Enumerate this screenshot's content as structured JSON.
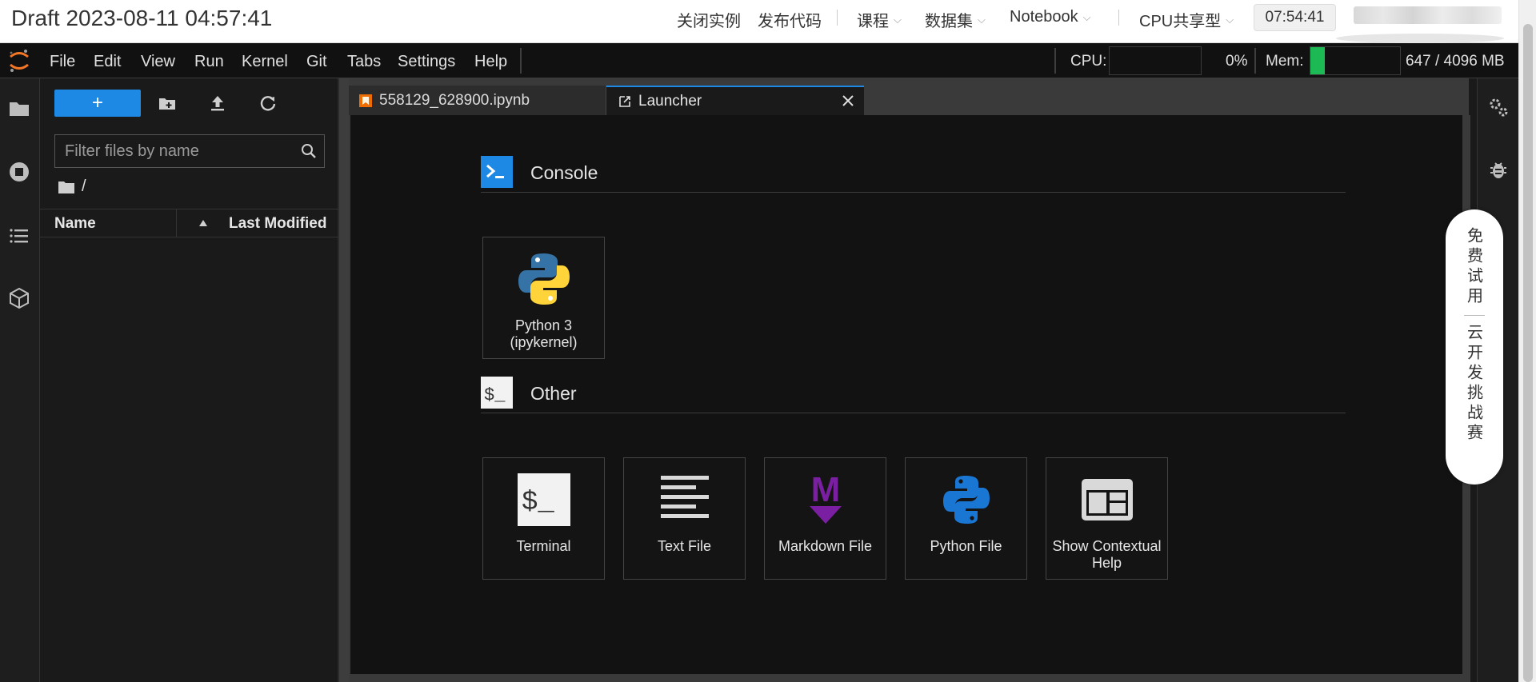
{
  "topbar": {
    "draft_title": "Draft 2023-08-11 04:57:41",
    "actions": [
      "关闭实例",
      "发布代码"
    ],
    "dropdowns": [
      "课程",
      "数据集",
      "Notebook",
      "CPU共享型"
    ],
    "timer": "07:54:41"
  },
  "menu": {
    "items": [
      "File",
      "Edit",
      "View",
      "Run",
      "Kernel",
      "Git",
      "Tabs",
      "Settings",
      "Help"
    ]
  },
  "resources": {
    "cpu_label": "CPU:",
    "cpu_value": "0%",
    "cpu_percent": 0,
    "mem_label": "Mem:",
    "mem_value": "647 / 4096 MB",
    "mem_fraction": 0.158
  },
  "filebrowser": {
    "filter_placeholder": "Filter files by name",
    "breadcrumb": "/",
    "col_name": "Name",
    "col_modified": "Last Modified",
    "new_button_symbol": "+"
  },
  "tabs": [
    {
      "label": "558129_628900.ipynb",
      "icon": "notebook-icon",
      "active": false
    },
    {
      "label": "Launcher",
      "icon": "launcher-icon",
      "active": true
    }
  ],
  "launcher": {
    "sections": [
      {
        "title": "Console",
        "icon": "console-prompt-icon"
      },
      {
        "title": "Other",
        "icon": "terminal-dollar-icon"
      }
    ],
    "console_cards": [
      {
        "label": "Python 3 (ipykernel)",
        "icon": "python-logo-icon"
      }
    ],
    "other_cards": [
      {
        "label": "Terminal",
        "icon": "terminal-icon"
      },
      {
        "label": "Text File",
        "icon": "text-file-icon"
      },
      {
        "label": "Markdown File",
        "icon": "markdown-icon"
      },
      {
        "label": "Python File",
        "icon": "python-file-icon"
      },
      {
        "label": "Show Contextual Help",
        "icon": "contextual-help-icon"
      }
    ]
  },
  "promo": {
    "line1": "免费试用",
    "line2": "云开发挑战赛"
  },
  "colors": {
    "accent": "#1e88e5",
    "mem_fill": "#1db954",
    "markdown": "#7b1fa2",
    "python_blue": "#1976d2"
  }
}
